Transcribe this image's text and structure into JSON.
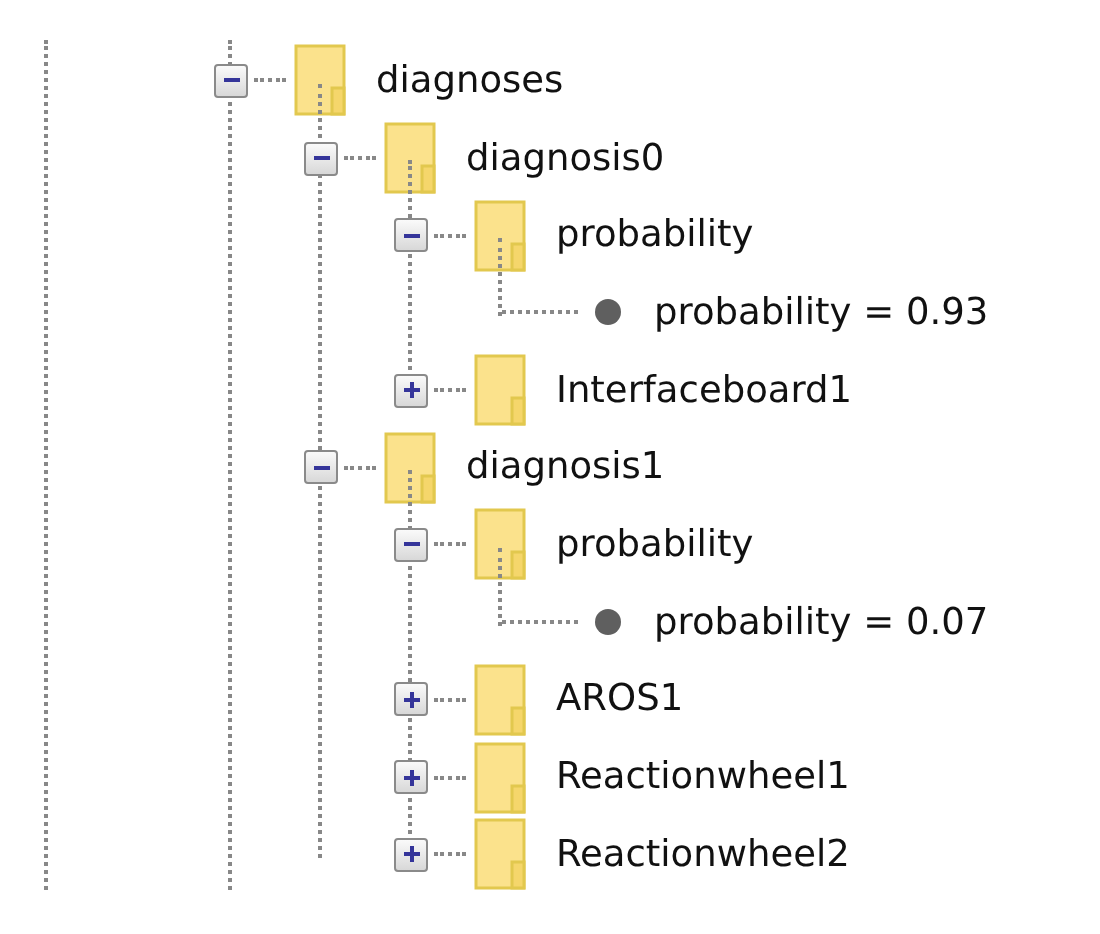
{
  "tree": [
    {
      "label": "diagnoses",
      "kind": "folder",
      "expanded": true,
      "children": [
        {
          "label": "diagnosis0",
          "kind": "folder",
          "expanded": true,
          "children": [
            {
              "label": "probability",
              "kind": "folder",
              "expanded": true,
              "children": [
                {
                  "label": "probability = 0.93",
                  "kind": "value"
                }
              ]
            },
            {
              "label": "Interfaceboard1",
              "kind": "folder",
              "expanded": false
            }
          ]
        },
        {
          "label": "diagnosis1",
          "kind": "folder",
          "expanded": true,
          "children": [
            {
              "label": "probability",
              "kind": "folder",
              "expanded": true,
              "children": [
                {
                  "label": "probability = 0.07",
                  "kind": "value"
                }
              ]
            },
            {
              "label": "AROS1",
              "kind": "folder",
              "expanded": false
            },
            {
              "label": "Reactionwheel1",
              "kind": "folder",
              "expanded": false
            },
            {
              "label": "Reactionwheel2",
              "kind": "folder",
              "expanded": false
            }
          ]
        }
      ]
    }
  ]
}
